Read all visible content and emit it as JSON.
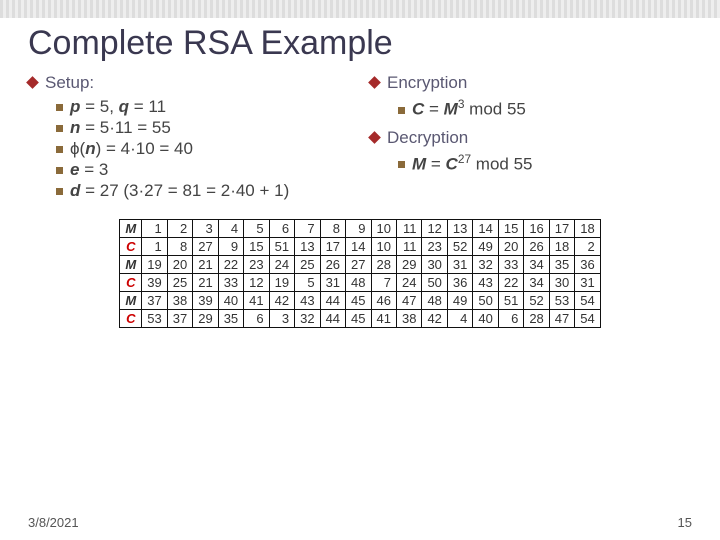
{
  "title": "Complete RSA Example",
  "left": {
    "heading": "Setup:",
    "items": [
      {
        "pre": "p",
        "mid": " = 5, ",
        "mid_var": "q",
        "post": " = 11"
      },
      {
        "pre": "n",
        "post": " = 5·11 = 55"
      },
      {
        "phi": true,
        "post": " = 4·10 = 40"
      },
      {
        "pre": "e",
        "post": " = 3"
      },
      {
        "pre": "d",
        "post": " = 27 (3·27 = 81 = 2·40 + 1)"
      }
    ]
  },
  "right": {
    "enc_head": "Encryption",
    "enc_var": "C",
    "enc_eq": " = ",
    "enc_base": "M",
    "enc_exp": "3",
    "enc_post": " mod 55",
    "dec_head": "Decryption",
    "dec_var": "M",
    "dec_eq": " = ",
    "dec_base": "C",
    "dec_exp": "27",
    "dec_post": " mod 55"
  },
  "chart_data": {
    "type": "table",
    "row_labels": [
      "M",
      "C",
      "M",
      "C",
      "M",
      "C"
    ],
    "rows": [
      [
        1,
        2,
        3,
        4,
        5,
        6,
        7,
        8,
        9,
        10,
        11,
        12,
        13,
        14,
        15,
        16,
        17,
        18
      ],
      [
        1,
        8,
        27,
        9,
        15,
        51,
        13,
        17,
        14,
        10,
        11,
        23,
        52,
        49,
        20,
        26,
        18,
        2
      ],
      [
        19,
        20,
        21,
        22,
        23,
        24,
        25,
        26,
        27,
        28,
        29,
        30,
        31,
        32,
        33,
        34,
        35,
        36
      ],
      [
        39,
        25,
        21,
        33,
        12,
        19,
        5,
        31,
        48,
        7,
        24,
        50,
        36,
        43,
        22,
        34,
        30,
        31
      ],
      [
        37,
        38,
        39,
        40,
        41,
        42,
        43,
        44,
        45,
        46,
        47,
        48,
        49,
        50,
        51,
        52,
        53,
        54
      ],
      [
        53,
        37,
        29,
        35,
        6,
        3,
        32,
        44,
        45,
        41,
        38,
        42,
        4,
        40,
        6,
        28,
        47,
        54
      ]
    ]
  },
  "footer": {
    "date": "3/8/2021",
    "page": "15"
  }
}
